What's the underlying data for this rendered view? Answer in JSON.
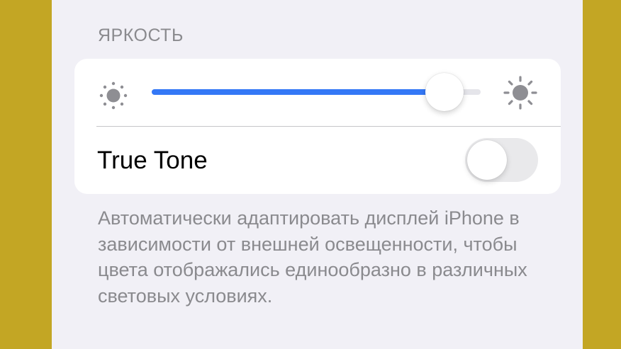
{
  "brightness_section": {
    "header": "ЯРКОСТЬ"
  },
  "brightness_slider": {
    "value_fraction": 0.89,
    "min_icon": "sun-min-icon",
    "max_icon": "sun-max-icon",
    "fill_color": "#3478f6"
  },
  "true_tone": {
    "label": "True Tone",
    "enabled": false
  },
  "footer": {
    "description": "Автоматически адаптировать дисплей iPhone в зависимости от внешней освещенности, чтобы цвета отображались единообразно в различных световых условиях."
  },
  "colors": {
    "outer_background": "#c3a624",
    "screen_background": "#f1f0f6",
    "card_background": "#ffffff",
    "secondary_text": "#8a8a8e"
  }
}
